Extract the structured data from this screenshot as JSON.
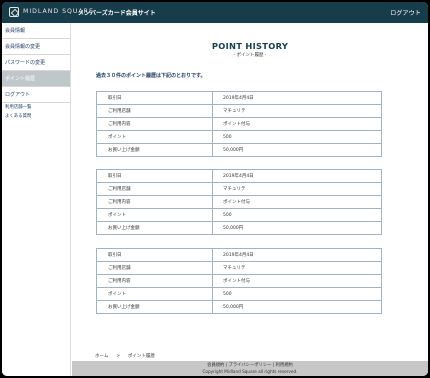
{
  "header": {
    "brand": "MIDLAND SQUARE",
    "site_title": "メンバーズカード会員サイト",
    "logout": "ログアウト"
  },
  "sidebar": {
    "items": [
      {
        "label": "会員情報"
      },
      {
        "label": "会員情報の変更"
      },
      {
        "label": "パスワードの変更"
      },
      {
        "label": "ポイント履歴",
        "active": true
      },
      {
        "label": "ログアウト"
      }
    ],
    "links": [
      {
        "label": "利用店舗一覧"
      },
      {
        "label": "よくある質問"
      }
    ]
  },
  "main": {
    "title": "POINT HISTORY",
    "subtitle": "- ポイント履歴 -",
    "intro": "過去３０件のポイント履歴は下記のとおりです。",
    "records": [
      {
        "rows": [
          {
            "label": "取引日",
            "value": "2019年4月4日"
          },
          {
            "label": "ご利用店舗",
            "value": "マチュリテ"
          },
          {
            "label": "ご利用内容",
            "value": "ポイント付与"
          },
          {
            "label": "ポイント",
            "value": "500"
          },
          {
            "label": "お買い上げ金額",
            "value": "50,000円"
          }
        ]
      },
      {
        "rows": [
          {
            "label": "取引日",
            "value": "2019年4月4日"
          },
          {
            "label": "ご利用店舗",
            "value": "マチュリテ"
          },
          {
            "label": "ご利用内容",
            "value": "ポイント付与"
          },
          {
            "label": "ポイント",
            "value": "500"
          },
          {
            "label": "お買い上げ金額",
            "value": "50,000円"
          }
        ]
      },
      {
        "rows": [
          {
            "label": "取引日",
            "value": "2019年4月4日"
          },
          {
            "label": "ご利用店舗",
            "value": "マチュリテ"
          },
          {
            "label": "ご利用内容",
            "value": "ポイント付与"
          },
          {
            "label": "ポイント",
            "value": "500"
          },
          {
            "label": "お買い上げ金額",
            "value": "50,000円"
          }
        ]
      }
    ]
  },
  "breadcrumb": {
    "home": "ホーム",
    "separator": ">",
    "current": "ポイント履歴"
  },
  "footer": {
    "links": [
      "会員規約",
      "プライバシーポリシー",
      "利用規約"
    ],
    "divider": "|",
    "copyright": "Copyright Midland Square all rights reserved."
  },
  "colors": {
    "header_bg": "#173d4b",
    "active_bg": "#bfc7ca",
    "table_border": "#9eb4c2",
    "footer_bg": "#c7c7c7"
  }
}
